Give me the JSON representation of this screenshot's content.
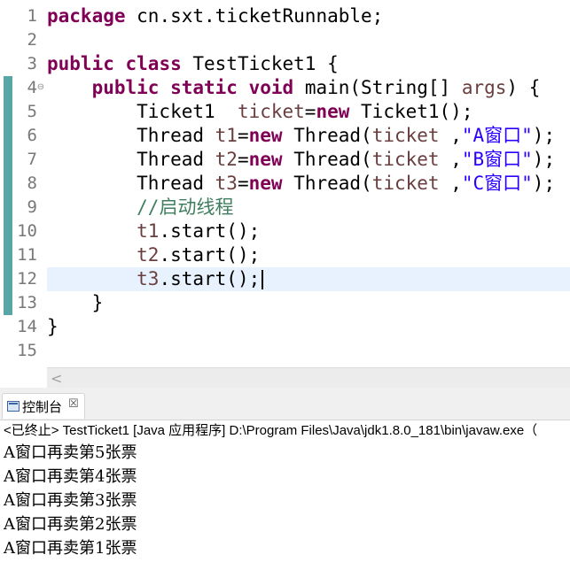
{
  "editor": {
    "line_numbers": [
      "1",
      "2",
      "3",
      "4",
      "5",
      "6",
      "7",
      "8",
      "9",
      "10",
      "11",
      "12",
      "13",
      "14",
      "15"
    ],
    "fold_marker": "⊖",
    "lines": [
      [
        {
          "t": "package",
          "c": "kw"
        },
        {
          "t": " cn.sxt.ticketRunnable;",
          "c": ""
        }
      ],
      [],
      [
        {
          "t": "public",
          "c": "kw"
        },
        {
          "t": " ",
          "c": ""
        },
        {
          "t": "class",
          "c": "kw"
        },
        {
          "t": " TestTicket1 {",
          "c": ""
        }
      ],
      [
        {
          "t": "    ",
          "c": ""
        },
        {
          "t": "public",
          "c": "kw"
        },
        {
          "t": " ",
          "c": ""
        },
        {
          "t": "static",
          "c": "kw"
        },
        {
          "t": " ",
          "c": ""
        },
        {
          "t": "void",
          "c": "kw"
        },
        {
          "t": " main(String[] ",
          "c": ""
        },
        {
          "t": "args",
          "c": "var"
        },
        {
          "t": ") {",
          "c": ""
        }
      ],
      [
        {
          "t": "        Ticket1  ",
          "c": ""
        },
        {
          "t": "ticket",
          "c": "var"
        },
        {
          "t": "=",
          "c": ""
        },
        {
          "t": "new",
          "c": "kw"
        },
        {
          "t": " Ticket1();",
          "c": ""
        }
      ],
      [
        {
          "t": "        Thread ",
          "c": ""
        },
        {
          "t": "t1",
          "c": "var"
        },
        {
          "t": "=",
          "c": ""
        },
        {
          "t": "new",
          "c": "kw"
        },
        {
          "t": " Thread(",
          "c": ""
        },
        {
          "t": "ticket",
          "c": "var"
        },
        {
          "t": " ,",
          "c": ""
        },
        {
          "t": "\"A窗口\"",
          "c": "str"
        },
        {
          "t": ");",
          "c": ""
        }
      ],
      [
        {
          "t": "        Thread ",
          "c": ""
        },
        {
          "t": "t2",
          "c": "var"
        },
        {
          "t": "=",
          "c": ""
        },
        {
          "t": "new",
          "c": "kw"
        },
        {
          "t": " Thread(",
          "c": ""
        },
        {
          "t": "ticket",
          "c": "var"
        },
        {
          "t": " ,",
          "c": ""
        },
        {
          "t": "\"B窗口\"",
          "c": "str"
        },
        {
          "t": ");",
          "c": ""
        }
      ],
      [
        {
          "t": "        Thread ",
          "c": ""
        },
        {
          "t": "t3",
          "c": "var"
        },
        {
          "t": "=",
          "c": ""
        },
        {
          "t": "new",
          "c": "kw"
        },
        {
          "t": " Thread(",
          "c": ""
        },
        {
          "t": "ticket",
          "c": "var"
        },
        {
          "t": " ,",
          "c": ""
        },
        {
          "t": "\"C窗口\"",
          "c": "str"
        },
        {
          "t": ");",
          "c": ""
        }
      ],
      [
        {
          "t": "        ",
          "c": ""
        },
        {
          "t": "//启动线程",
          "c": "cmt"
        }
      ],
      [
        {
          "t": "        ",
          "c": ""
        },
        {
          "t": "t1",
          "c": "var"
        },
        {
          "t": ".start();",
          "c": ""
        }
      ],
      [
        {
          "t": "        ",
          "c": ""
        },
        {
          "t": "t2",
          "c": "var"
        },
        {
          "t": ".start();",
          "c": ""
        }
      ],
      [
        {
          "t": "        ",
          "c": ""
        },
        {
          "t": "t3",
          "c": "var"
        },
        {
          "t": ".start();",
          "c": ""
        }
      ],
      [
        {
          "t": "    }",
          "c": ""
        }
      ],
      [
        {
          "t": "}",
          "c": ""
        }
      ],
      []
    ],
    "colors": {
      "keyword": "#7f0055",
      "variable": "#6a3e3e",
      "string": "#2a00ff",
      "comment": "#3f7f5f",
      "current_line": "#e8f2fe",
      "change_bar": "#58a6a6"
    }
  },
  "hscroll": {
    "left_arrow": "<"
  },
  "console": {
    "tab_label": "控制台",
    "tab_close": "☒",
    "status": "<已终止> TestTicket1 [Java 应用程序] D:\\Program Files\\Java\\jdk1.8.0_181\\bin\\javaw.exe（",
    "output": [
      "A窗口再卖第5张票",
      "A窗口再卖第4张票",
      "A窗口再卖第3张票",
      "A窗口再卖第2张票",
      "A窗口再卖第1张票"
    ]
  }
}
